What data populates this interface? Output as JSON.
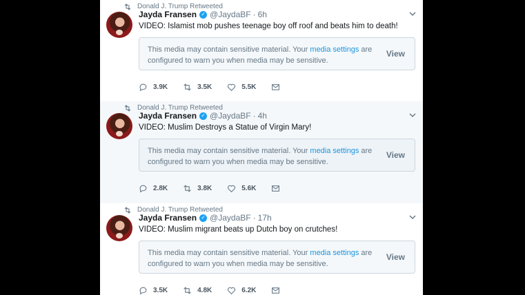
{
  "tweets": [
    {
      "retweet_label": "Donald J. Trump Retweeted",
      "name": "Jayda Fransen",
      "handle": "@JaydaBF",
      "separator": "·",
      "time": "6h",
      "text": "VIDEO: Islamist mob pushes teenage boy off roof and beats him to death!",
      "warning_pre": "This media may contain sensitive material. Your",
      "warning_link": "media settings",
      "warning_post": "are configured to warn you when media may be sensitive.",
      "view_label": "View",
      "replies": "3.9K",
      "retweets": "3.5K",
      "likes": "5.5K"
    },
    {
      "retweet_label": "Donald J. Trump Retweeted",
      "name": "Jayda Fransen",
      "handle": "@JaydaBF",
      "separator": "·",
      "time": "4h",
      "text": "VIDEO: Muslim Destroys a Statue of Virgin Mary!",
      "warning_pre": "This media may contain sensitive material. Your",
      "warning_link": "media settings",
      "warning_post": "are configured to warn you when media may be sensitive.",
      "view_label": "View",
      "replies": "2.8K",
      "retweets": "3.8K",
      "likes": "5.6K"
    },
    {
      "retweet_label": "Donald J. Trump Retweeted",
      "name": "Jayda Fransen",
      "handle": "@JaydaBF",
      "separator": "·",
      "time": "17h",
      "text": "VIDEO: Muslim migrant beats up Dutch boy on crutches!",
      "warning_pre": "This media may contain sensitive material. Your",
      "warning_link": "media settings",
      "warning_post": "are configured to warn you when media may be sensitive.",
      "view_label": "View",
      "replies": "3.5K",
      "retweets": "4.8K",
      "likes": "6.2K"
    }
  ],
  "icons": {
    "retweeted": "retweet-icon",
    "verified": "verified-badge-icon",
    "menu": "chevron-down-icon",
    "reply": "reply-icon",
    "retweet": "retweet-icon",
    "like": "heart-icon",
    "message": "envelope-icon"
  },
  "colors": {
    "link": "#1b95e0",
    "verified": "#1da1f2",
    "muted": "#657786"
  }
}
